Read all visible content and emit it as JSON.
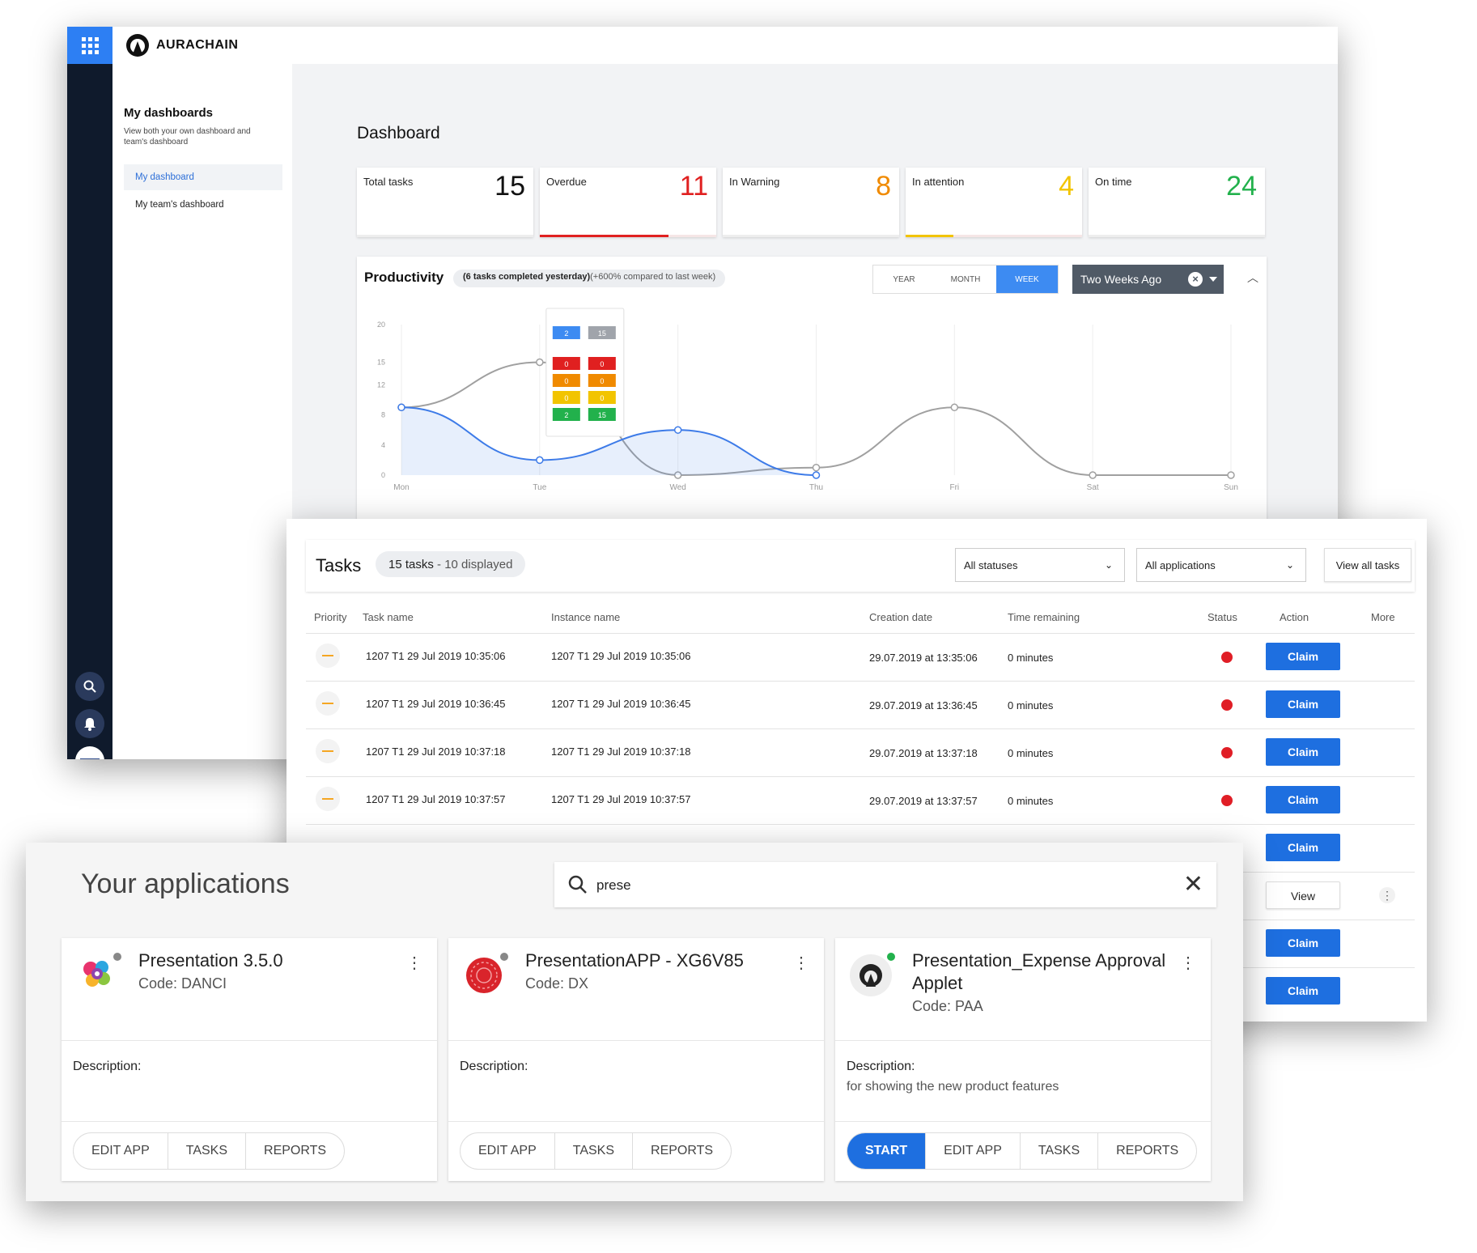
{
  "dashboard_window": {
    "brand": "AURACHAIN",
    "sidebar": {
      "title": "My dashboards",
      "subtitle": "View both your own dashboard and team's dashboard",
      "items": [
        {
          "label": "My dashboard",
          "active": true
        },
        {
          "label": "My team's dashboard",
          "active": false
        }
      ]
    },
    "page_title": "Dashboard",
    "kpis": [
      {
        "label": "Total tasks",
        "value": "15",
        "color": "#111111",
        "bar_color": "#e0e0e0",
        "bar_fraction": 0
      },
      {
        "label": "Overdue",
        "value": "11",
        "color": "#e02020",
        "bar_color": "#e02020",
        "bar_fraction": 0.73
      },
      {
        "label": "In Warning",
        "value": "8",
        "color": "#f08a00",
        "bar_color": "#f08a00",
        "bar_fraction": 0
      },
      {
        "label": "In attention",
        "value": "4",
        "color": "#f2c400",
        "bar_color": "#f2c400",
        "bar_fraction": 0.27
      },
      {
        "label": "On time",
        "value": "24",
        "color": "#22b14c",
        "bar_color": "#22b14c",
        "bar_fraction": 0
      }
    ],
    "productivity": {
      "title": "Productivity",
      "pill_bold": "(6 tasks completed yesterday)",
      "pill_rest": "(+600% compared to last week)",
      "tabs": [
        "YEAR",
        "MONTH",
        "WEEK"
      ],
      "active_tab": "WEEK",
      "range": "Two Weeks Ago",
      "colors": {
        "this_week": "#3d7be8",
        "previous": "#a0a0a0"
      }
    }
  },
  "chart_data": {
    "type": "line",
    "x": [
      "Mon",
      "Tue",
      "Wed",
      "Thu",
      "Fri",
      "Sat",
      "Sun"
    ],
    "yticks": [
      0,
      4,
      8,
      12,
      15,
      20
    ],
    "ylim": [
      0,
      20
    ],
    "series": [
      {
        "values": [
          9,
          15,
          0,
          1,
          9,
          0,
          0
        ]
      },
      {
        "values": [
          9,
          2,
          6,
          0,
          null,
          null,
          null
        ]
      }
    ],
    "tooltip": {
      "day": "Tue",
      "header": [
        "2",
        "15"
      ],
      "rows": [
        {
          "color": "#e02020",
          "values": [
            "0",
            "0"
          ]
        },
        {
          "color": "#f08a00",
          "values": [
            "0",
            "0"
          ]
        },
        {
          "color": "#f2c400",
          "values": [
            "0",
            "0"
          ]
        },
        {
          "color": "#22b14c",
          "values": [
            "2",
            "15"
          ]
        }
      ]
    }
  },
  "tasks_window": {
    "title": "Tasks",
    "count_bold": "15 tasks",
    "count_rest": " - 10 displayed",
    "status_filter": "All statuses",
    "app_filter": "All applications",
    "view_all": "View all tasks",
    "columns": [
      "Priority",
      "Task name",
      "Instance name",
      "Creation date",
      "Time remaining",
      "Status",
      "Action",
      "More"
    ],
    "rows": [
      {
        "task": "1207 T1 29 Jul 2019 10:35:06",
        "instance": "1207 T1 29 Jul 2019 10:35:06",
        "created": "29.07.2019 at 13:35:06",
        "remaining": "0 minutes",
        "action": "Claim"
      },
      {
        "task": "1207 T1 29 Jul 2019 10:36:45",
        "instance": "1207 T1 29 Jul 2019 10:36:45",
        "created": "29.07.2019 at 13:36:45",
        "remaining": "0 minutes",
        "action": "Claim"
      },
      {
        "task": "1207 T1 29 Jul 2019 10:37:18",
        "instance": "1207 T1 29 Jul 2019 10:37:18",
        "created": "29.07.2019 at 13:37:18",
        "remaining": "0 minutes",
        "action": "Claim"
      },
      {
        "task": "1207 T1 29 Jul 2019 10:37:57",
        "instance": "1207 T1 29 Jul 2019 10:37:57",
        "created": "29.07.2019 at 13:37:57",
        "remaining": "0 minutes",
        "action": "Claim"
      }
    ],
    "hidden_row_actions": [
      "Claim",
      "View",
      "Claim",
      "Claim"
    ]
  },
  "apps_window": {
    "title": "Your applications",
    "search_value": "prese",
    "apps": [
      {
        "name": "Presentation 3.5.0",
        "code": "Code: DANCI",
        "desc_label": "Description:",
        "desc": "",
        "actions": [
          "EDIT APP",
          "TASKS",
          "REPORTS"
        ],
        "status_color": "#888888",
        "icon": "colorful-logo-icon"
      },
      {
        "name": "PresentationAPP - XG6V85",
        "code": "Code: DX",
        "desc_label": "Description:",
        "desc": "",
        "actions": [
          "EDIT APP",
          "TASKS",
          "REPORTS"
        ],
        "status_color": "#888888",
        "icon": "red-seal-icon"
      },
      {
        "name": "Presentation_Expense Approval Applet",
        "code": "Code: PAA",
        "desc_label": "Description:",
        "desc": "for showing the new product features",
        "actions": [
          "START",
          "EDIT APP",
          "TASKS",
          "REPORTS"
        ],
        "status_color": "#22b14c",
        "icon": "aurachain-logo-icon"
      }
    ]
  }
}
